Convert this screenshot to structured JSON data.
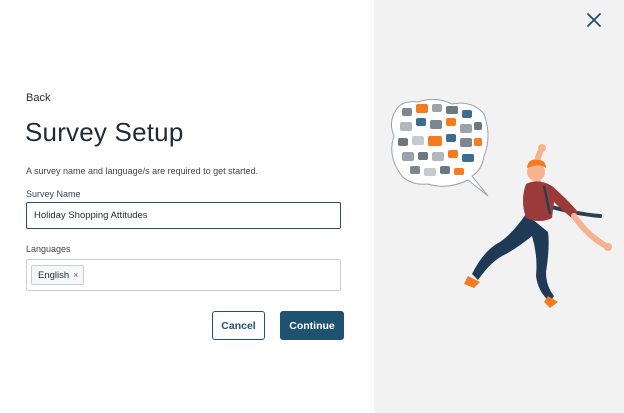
{
  "nav": {
    "back_label": "Back"
  },
  "page": {
    "title": "Survey Setup",
    "subtitle": "A survey name and language/s are required to get started."
  },
  "form": {
    "survey_name": {
      "label": "Survey Name",
      "value": "Holiday Shopping Attitudes"
    },
    "languages": {
      "label": "Languages",
      "chips": [
        {
          "label": "English",
          "remove_glyph": "×"
        }
      ]
    }
  },
  "actions": {
    "cancel_label": "Cancel",
    "continue_label": "Continue"
  },
  "icons": {
    "close": "close-icon"
  },
  "colors": {
    "primary": "#1f5170",
    "side_panel_bg": "#f2f2f2",
    "accent_orange": "#f47b20"
  }
}
